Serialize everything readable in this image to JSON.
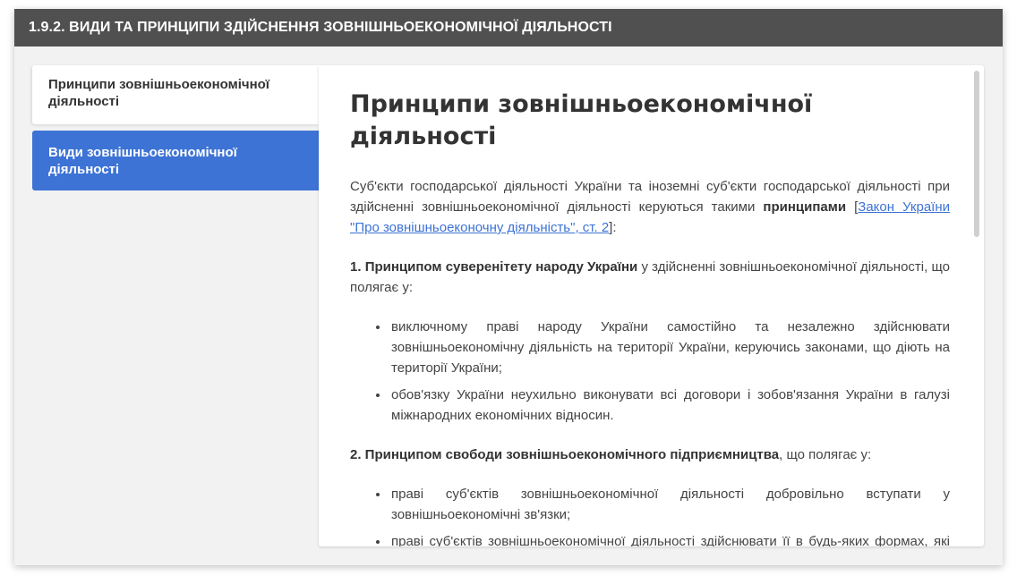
{
  "header": {
    "title": "1.9.2. ВИДИ ТА ПРИНЦИПИ ЗДІЙСНЕННЯ ЗОВНІШНЬОЕКОНОМІЧНОЇ ДІЯЛЬНОСТІ"
  },
  "tabs": [
    {
      "label": "Принципи зовнішньоекономічної діяльності",
      "active": true
    },
    {
      "label": "Види зовнішньоекономічної діяльності",
      "active": false
    }
  ],
  "content": {
    "title": "Принципи зовнішньоекономічної діяльності",
    "intro_text": "Суб'єкти господарської діяльності України та іноземні суб'єкти господарської діяльності при здійсненні зовнішньоекономічної діяльності керуються такими ",
    "intro_bold": "принципами",
    "intro_link_open": " [",
    "intro_link": "Закон України \"Про зовнішньоеконочну діяльність\", ст. 2",
    "intro_link_close": "]:",
    "principle1_bold": "1. Принципом суверенітету народу України",
    "principle1_rest": " у здійсненні зовнішньоекономічної діяльності, що полягає у:",
    "principle1_items": [
      "виключному праві народу України самостійно та незалежно здійснювати зовнішньоекономічну діяльність на території України, керуючись законами, що діють на території України;",
      "обов'язку України неухильно виконувати всі договори і зобов'язання України в галузі міжнародних економічних відносин."
    ],
    "principle2_bold": "2. Принципом свободи зовнішньоекономічного підприємництва",
    "principle2_rest": ", що полягає у:",
    "principle2_items": [
      "праві суб'єктів зовнішньоекономічної діяльності добровільно вступати у зовнішньоекономічні зв'язки;",
      "праві суб'єктів зовнішньоекономічної діяльності здійснювати її в будь-яких формах, які прямо не заборонені законами України;"
    ]
  },
  "colors": {
    "header_bg": "#505050",
    "active_tab_bg": "#ffffff",
    "inactive_tab_bg": "#3d73d5",
    "link": "#3d73d5"
  }
}
